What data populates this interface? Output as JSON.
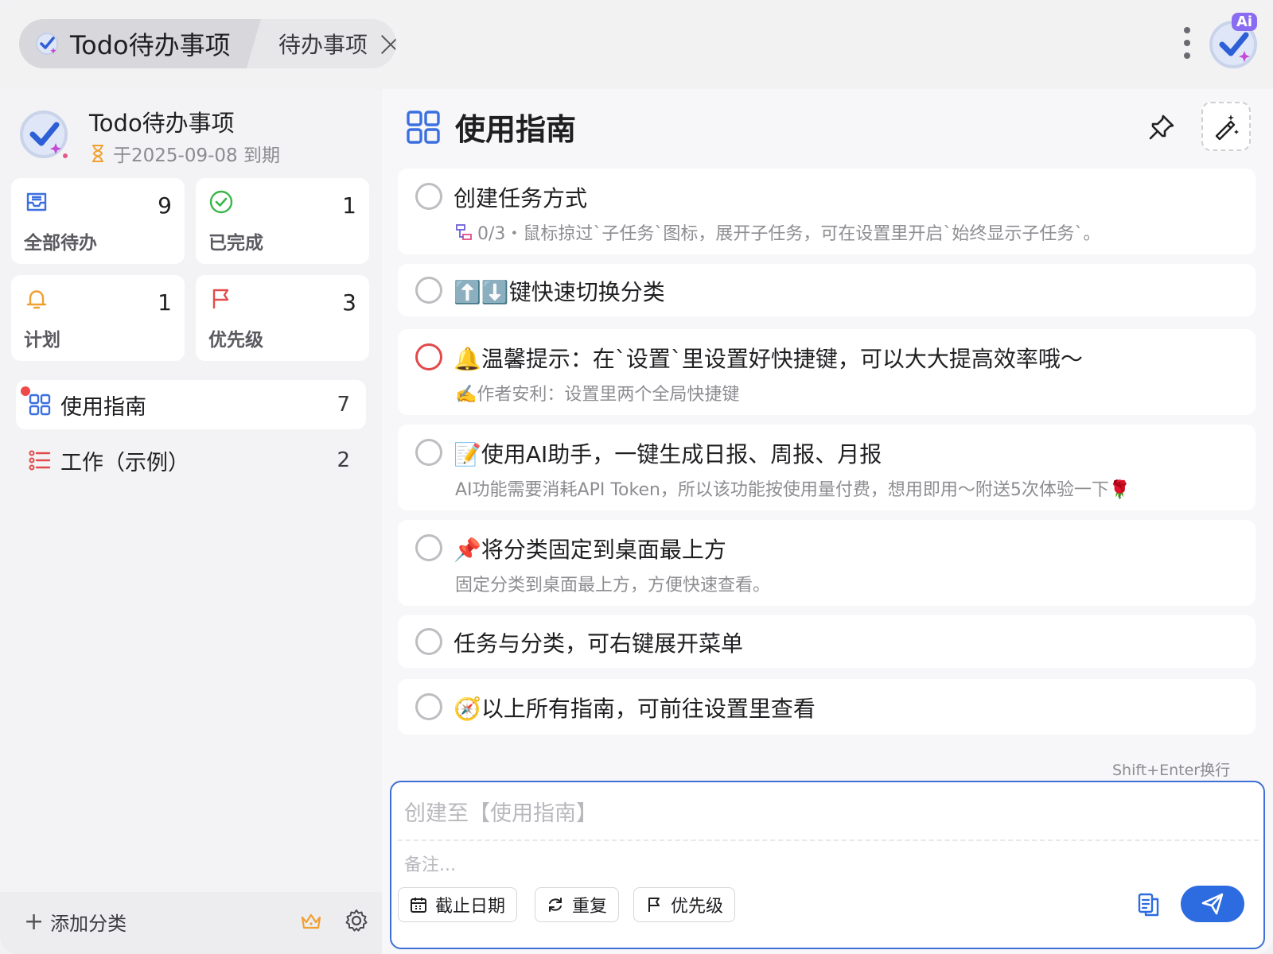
{
  "tabs": {
    "active_label": "Todo待办事项",
    "second_label": "待办事项"
  },
  "ai_badge": "Ai",
  "project": {
    "name": "Todo待办事项",
    "due": "于2025-09-08 到期"
  },
  "smart_lists": [
    {
      "label": "全部待办",
      "count": "9",
      "icon": "inbox-icon",
      "color": "#3b6fe0"
    },
    {
      "label": "已完成",
      "count": "1",
      "icon": "check-circle-icon",
      "color": "#39b54a"
    },
    {
      "label": "计划",
      "count": "1",
      "icon": "bell-icon",
      "color": "#f0a030"
    },
    {
      "label": "优先级",
      "count": "3",
      "icon": "flag-icon",
      "color": "#e24a4a"
    }
  ],
  "categories": [
    {
      "label": "使用指南",
      "count": "7",
      "icon": "grid-icon"
    },
    {
      "label": "工作（示例）",
      "count": "2",
      "icon": "list-icon"
    }
  ],
  "footer": {
    "add_category": "添加分类"
  },
  "main": {
    "title": "使用指南"
  },
  "tasks": [
    {
      "title": "创建任务方式",
      "subtitle": "0/3・鼠标掠过`子任务`图标，展开子任务，可在设置里开启`始终显示子任务`。",
      "priority": false
    },
    {
      "title": "⬆️⬇️键快速切换分类",
      "subtitle": "",
      "priority": false
    },
    {
      "title": "🔔温馨提示：在`设置`里设置好快捷键，可以大大提高效率哦～",
      "subtitle": "✍️作者安利：设置里两个全局快捷键",
      "priority": true
    },
    {
      "title": "📝使用AI助手，一键生成日报、周报、月报",
      "subtitle": "AI功能需要消耗API Token，所以该功能按使用量付费，想用即用～附送5次体验一下🌹",
      "priority": false
    },
    {
      "title": "📌将分类固定到桌面最上方",
      "subtitle": "固定分类到桌面最上方，方便快速查看。",
      "priority": false
    },
    {
      "title": "任务与分类，可右键展开菜单",
      "subtitle": "",
      "priority": false
    },
    {
      "title": "🧭以上所有指南，可前往设置里查看",
      "subtitle": "",
      "priority": false
    }
  ],
  "composer": {
    "hint": "Shift+Enter换行",
    "title_placeholder": "创建至【使用指南】",
    "note_placeholder": "备注...",
    "chip_date": "截止日期",
    "chip_repeat": "重复",
    "chip_priority": "优先级"
  }
}
